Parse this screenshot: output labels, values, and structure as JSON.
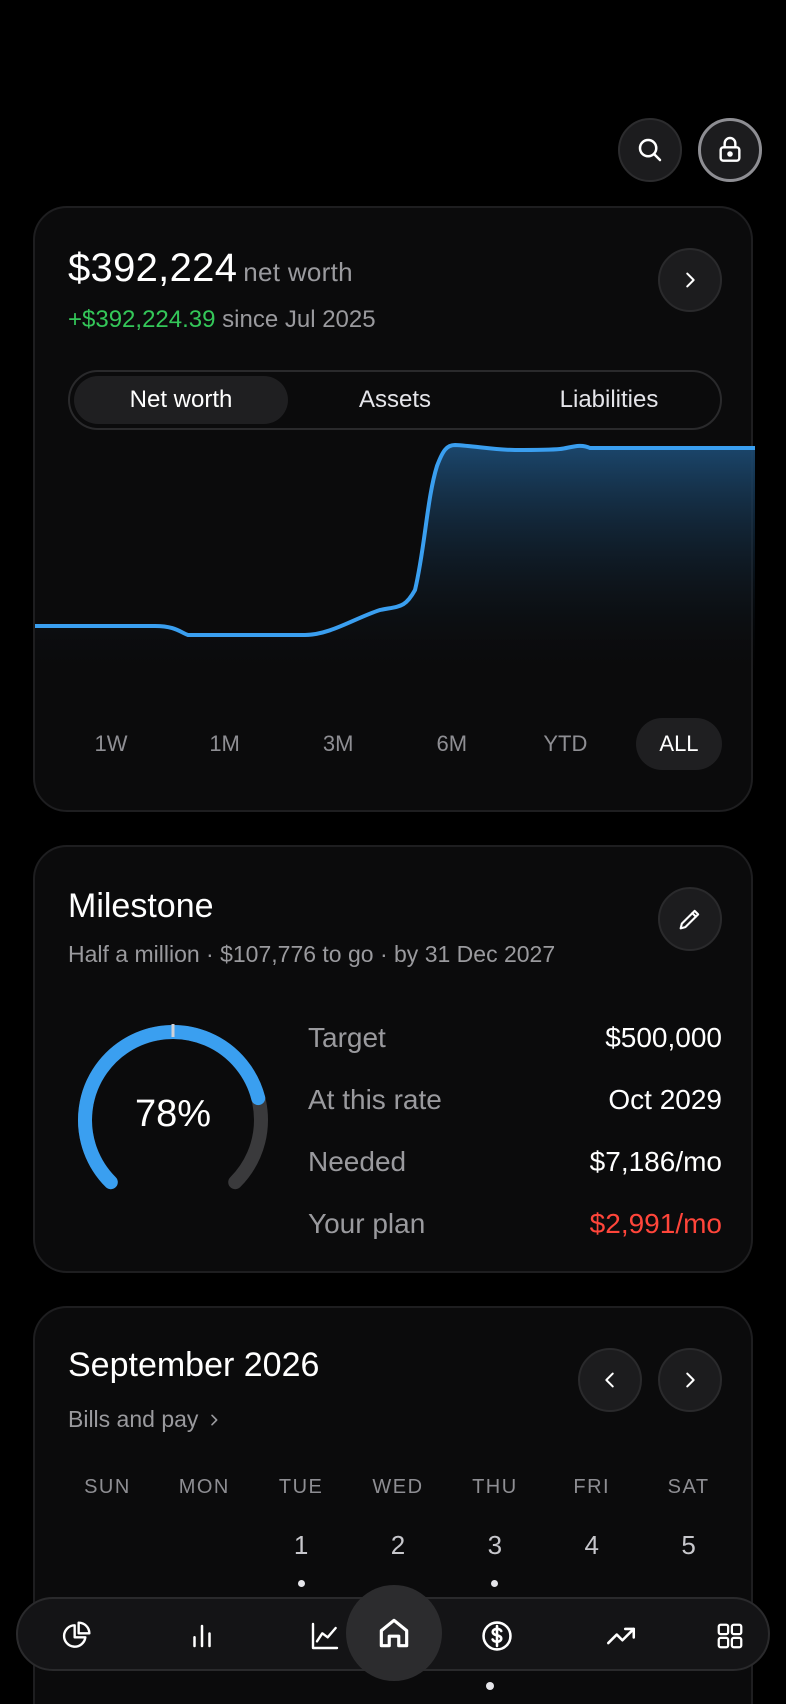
{
  "header": {
    "search_icon": "search-icon",
    "lock_icon": "lock-icon"
  },
  "net_worth": {
    "amount": "$392,224",
    "suffix": "net worth",
    "change_value": "+$392,224.39",
    "change_suffix": "since Jul 2025",
    "tabs": [
      "Net worth",
      "Assets",
      "Liabilities"
    ],
    "active_tab": "Net worth",
    "ranges": [
      "1W",
      "1M",
      "3M",
      "6M",
      "YTD",
      "ALL"
    ],
    "active_range": "ALL",
    "line_color": "#3a9ff0"
  },
  "milestone": {
    "title": "Milestone",
    "subtitle": "Half a million · $107,776 to go · by 31 Dec 2027",
    "percent": 78,
    "percent_label": "78%",
    "stats": [
      {
        "label": "Target",
        "value": "$500,000",
        "status": "normal"
      },
      {
        "label": "At this rate",
        "value": "Oct 2029",
        "status": "normal"
      },
      {
        "label": "Needed",
        "value": "$7,186/mo",
        "status": "normal"
      },
      {
        "label": "Your plan",
        "value": "$2,991/mo",
        "status": "negative"
      }
    ],
    "accent": "#3a9ff0",
    "negative_color": "#ff453a"
  },
  "calendar": {
    "title": "September 2026",
    "subtitle": "Bills and pay",
    "weekdays": [
      "SUN",
      "MON",
      "TUE",
      "WED",
      "THU",
      "FRI",
      "SAT"
    ],
    "first_row": [
      "",
      "",
      "1",
      "2",
      "3",
      "4",
      "5"
    ],
    "dots": [
      false,
      false,
      true,
      false,
      true,
      false,
      false
    ]
  },
  "nav": {
    "items": [
      "pie-chart-icon",
      "bar-chart-icon",
      "line-chart-icon",
      "home-icon",
      "dollar-icon",
      "trending-up-icon",
      "grid-icon"
    ],
    "active": "home-icon"
  }
}
